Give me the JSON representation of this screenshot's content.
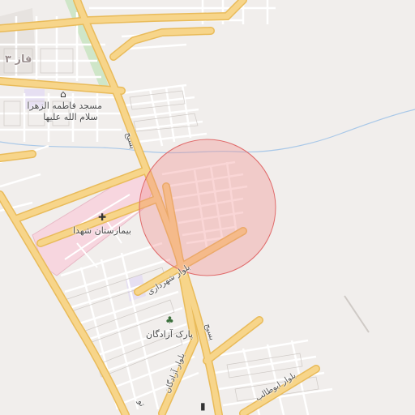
{
  "map": {
    "colors": {
      "background": "#f1eeec",
      "major_road": "#f7d58a",
      "major_road_casing": "#e9bb5a",
      "minor_road": "#ffffff",
      "block_outline": "#cfcac6",
      "hospital_area": "#f7d6df",
      "park_area": "#cfe6c8",
      "water": "#a9c8e8",
      "radius_fill": "#f08a8a",
      "radius_stroke": "#e06b6b"
    },
    "labels": {
      "district": "فاز ۳",
      "mosque_line1": "مسجد فاطمه الزهرا",
      "mosque_line2": "سلام الله علیها",
      "hospital": "بیمارستان شهدا",
      "park": "پارک آزادگان",
      "road_basij_north": "بسیج",
      "road_basij_south": "بسیج",
      "road_shahrdari": "بلوار شهرداری",
      "road_azadegan": "بلوار آزادگان",
      "road_abutaleb": "بلوار ابوطالب",
      "road_bottom_left": "تو"
    },
    "icons": {
      "mosque": "mosque-icon",
      "hospital": "hospital-cross-icon",
      "park": "tree-icon",
      "shop": "shop-icon"
    }
  }
}
